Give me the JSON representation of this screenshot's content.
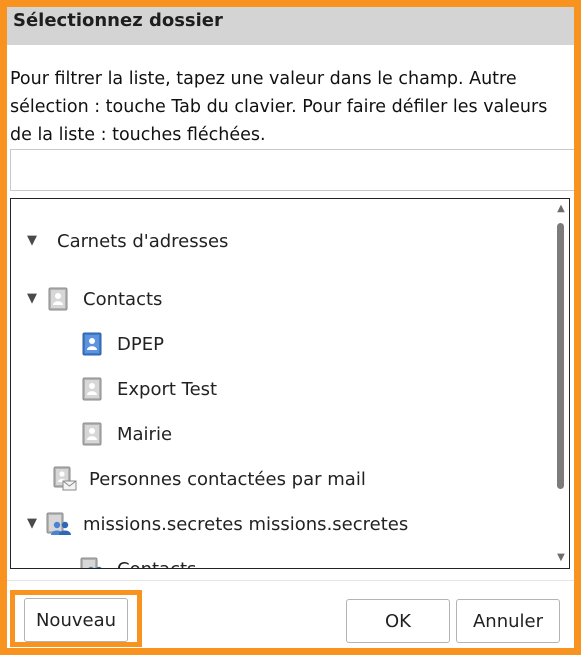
{
  "dialog": {
    "title": "Sélectionnez dossier",
    "instructions": [
      "Pour filtrer la liste, tapez une valeur dans le champ. Autre",
      "sélection : touche Tab du clavier. Pour faire défiler les valeurs",
      "de la liste : touches fléchées."
    ],
    "filter": {
      "value": "",
      "placeholder": ""
    }
  },
  "tree": {
    "items": [
      {
        "label": "Carnets d'adresses",
        "icon": "none",
        "expanded": true
      },
      {
        "label": "Contacts",
        "icon": "address-book-gray-icon",
        "expanded": true
      },
      {
        "label": "DPEP",
        "icon": "address-book-blue-icon",
        "expanded": false
      },
      {
        "label": "Export Test",
        "icon": "address-book-gray-icon",
        "expanded": false
      },
      {
        "label": "Mairie",
        "icon": "address-book-gray-icon",
        "expanded": false
      },
      {
        "label": "Personnes contactées par mail",
        "icon": "address-book-mail-icon",
        "expanded": false
      },
      {
        "label": "missions.secretes missions.secretes",
        "icon": "shared-address-book-icon",
        "expanded": true
      },
      {
        "label": "Contacts",
        "icon": "shared-contacts-icon",
        "expanded": false
      }
    ]
  },
  "footer": {
    "new_label": "Nouveau",
    "ok_label": "OK",
    "cancel_label": "Annuler"
  },
  "colors": {
    "highlight": "#f7931e",
    "title_bar": "#d4d4d4",
    "icon_gray": "#a9a9a9",
    "icon_blue": "#3f78c9",
    "shared_blue": "#4a83d4"
  }
}
